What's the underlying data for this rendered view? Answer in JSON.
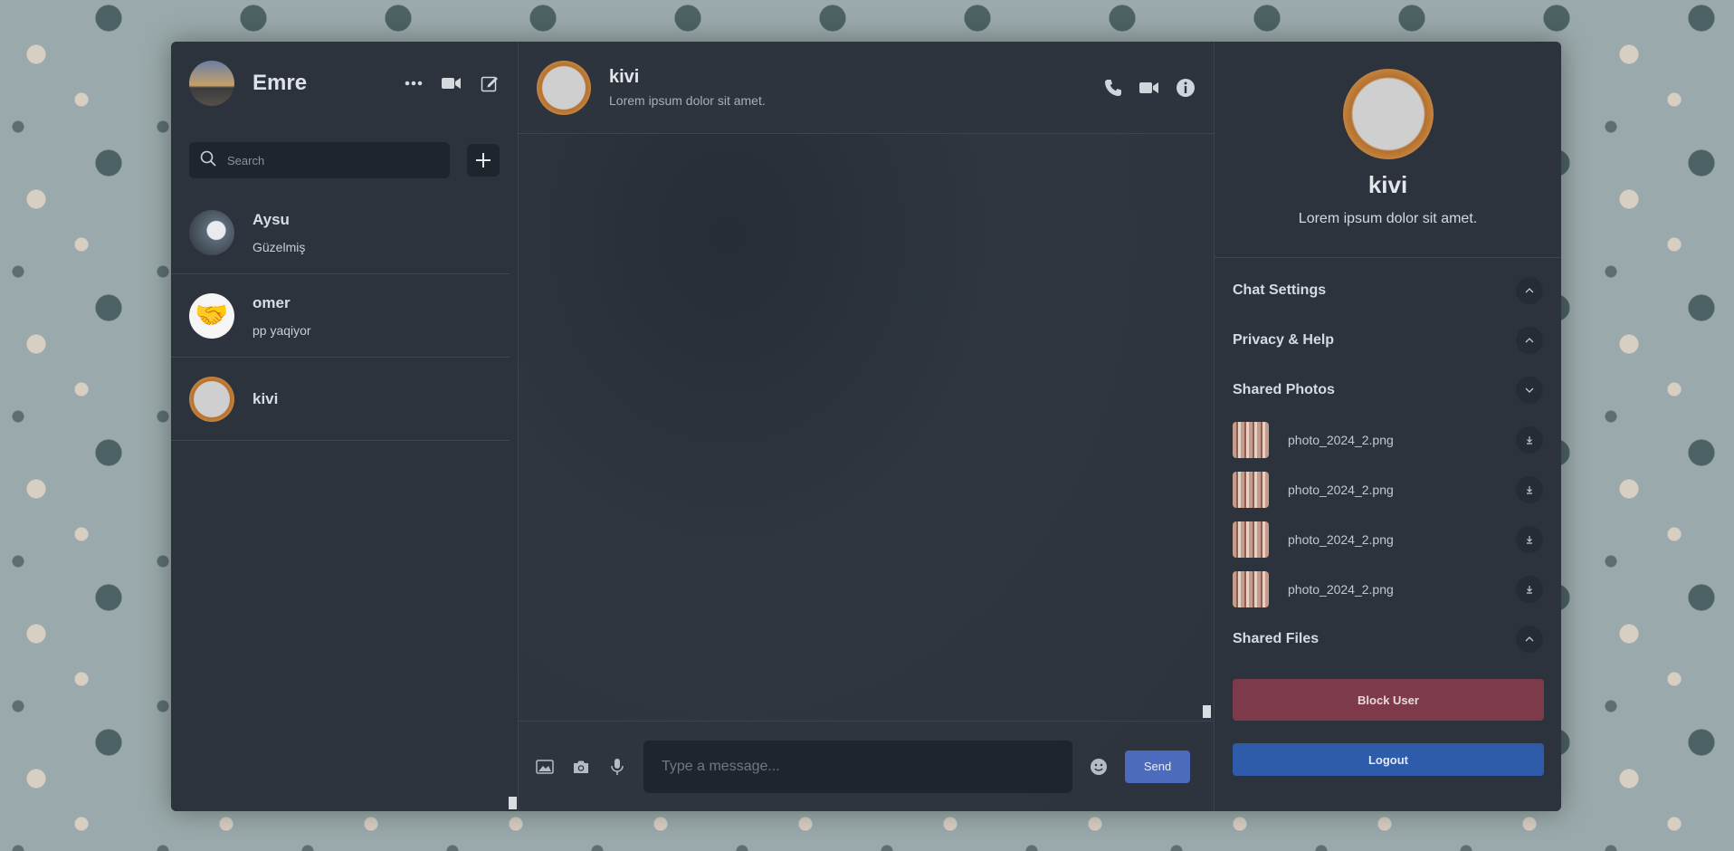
{
  "user": {
    "name": "Emre"
  },
  "search": {
    "placeholder": "Search"
  },
  "contacts": [
    {
      "name": "Aysu",
      "last_message": "Güzelmiş"
    },
    {
      "name": "omer",
      "last_message": "pp yaqiyor"
    },
    {
      "name": "kivi",
      "last_message": ""
    }
  ],
  "chat": {
    "name": "kivi",
    "status": "Lorem ipsum dolor sit amet."
  },
  "composer": {
    "placeholder": "Type a message...",
    "send_label": "Send"
  },
  "profile": {
    "name": "kivi",
    "status": "Lorem ipsum dolor sit amet."
  },
  "sections": {
    "chat_settings": "Chat Settings",
    "privacy_help": "Privacy & Help",
    "shared_photos": "Shared Photos",
    "shared_files": "Shared Files"
  },
  "shared_photos": [
    {
      "name": "photo_2024_2.png"
    },
    {
      "name": "photo_2024_2.png"
    },
    {
      "name": "photo_2024_2.png"
    },
    {
      "name": "photo_2024_2.png"
    }
  ],
  "actions": {
    "block_label": "Block User",
    "logout_label": "Logout"
  },
  "colors": {
    "block": "#7d3a4b",
    "logout": "#2f5bab",
    "send": "#4d6bbd",
    "panel": "#2c333c"
  }
}
